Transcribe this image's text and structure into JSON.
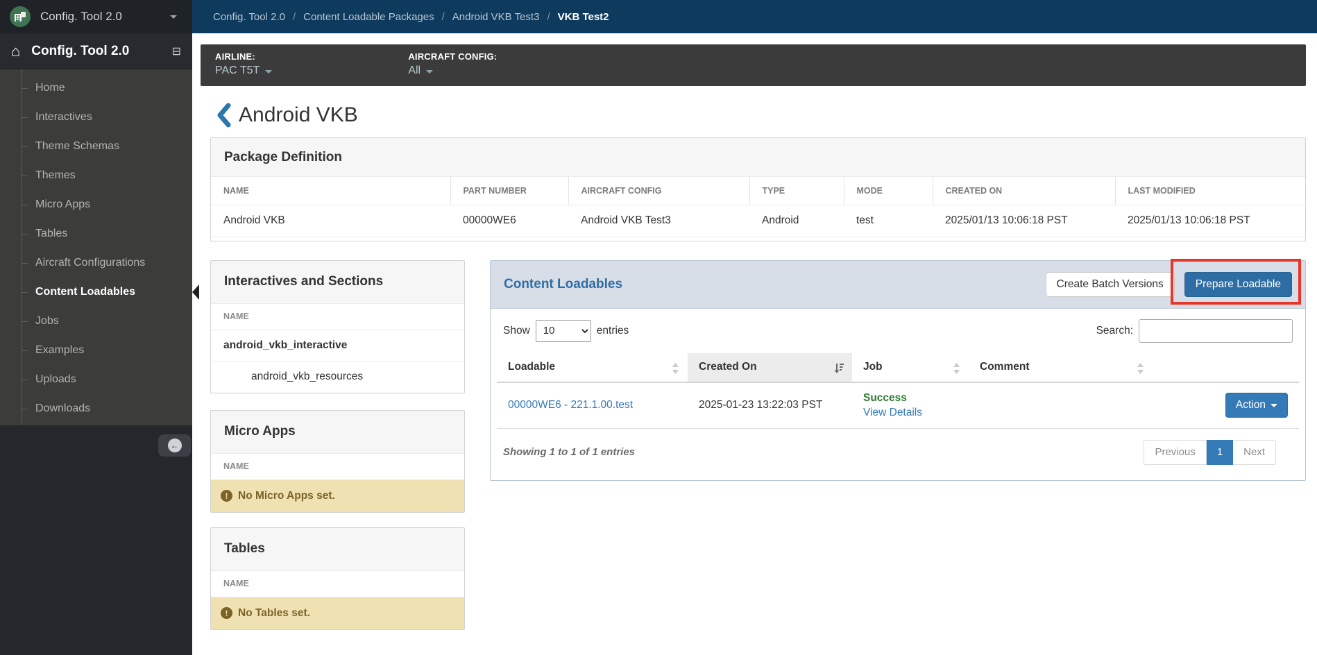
{
  "sidebar": {
    "brand_label": "Config. Tool 2.0",
    "header_label": "Config. Tool 2.0",
    "items": [
      {
        "label": "Home",
        "active": false
      },
      {
        "label": "Interactives",
        "active": false
      },
      {
        "label": "Theme Schemas",
        "active": false
      },
      {
        "label": "Themes",
        "active": false
      },
      {
        "label": "Micro Apps",
        "active": false
      },
      {
        "label": "Tables",
        "active": false
      },
      {
        "label": "Aircraft Configurations",
        "active": false
      },
      {
        "label": "Content Loadables",
        "active": true
      },
      {
        "label": "Jobs",
        "active": false
      },
      {
        "label": "Examples",
        "active": false
      },
      {
        "label": "Uploads",
        "active": false
      },
      {
        "label": "Downloads",
        "active": false
      }
    ]
  },
  "breadcrumb": {
    "separator": "/",
    "items": [
      "Config. Tool 2.0",
      "Content Loadable Packages",
      "Android VKB Test3",
      "VKB Test2"
    ]
  },
  "filter_bar": {
    "airline_label": "AIRLINE:",
    "airline_value": "PAC T5T",
    "aircraft_label": "AIRCRAFT CONFIG:",
    "aircraft_value": "All"
  },
  "page": {
    "title": "Android VKB"
  },
  "package_definition": {
    "title": "Package Definition",
    "columns": [
      "NAME",
      "PART NUMBER",
      "AIRCRAFT CONFIG",
      "TYPE",
      "MODE",
      "CREATED ON",
      "LAST MODIFIED"
    ],
    "values": [
      "Android VKB",
      "00000WE6",
      "Android VKB Test3",
      "Android",
      "test",
      "2025/01/13 10:06:18 PST",
      "2025/01/13 10:06:18 PST"
    ]
  },
  "interactives": {
    "title": "Interactives and Sections",
    "name_header": "NAME",
    "rows": [
      {
        "label": "android_vkb_interactive"
      },
      {
        "label": "android_vkb_resources"
      }
    ]
  },
  "micro_apps": {
    "title": "Micro Apps",
    "name_header": "NAME",
    "empty_message": "No Micro Apps set.",
    "warn_glyph": "!"
  },
  "tables_panel": {
    "title": "Tables",
    "name_header": "NAME",
    "empty_message": "No Tables set.",
    "warn_glyph": "!"
  },
  "content_loadables": {
    "title": "Content Loadables",
    "create_batch_label": "Create Batch Versions",
    "prepare_label": "Prepare Loadable",
    "show_label": "Show",
    "page_size": "10",
    "entries_label": "entries",
    "search_label": "Search:",
    "search_value": "",
    "columns": [
      "Loadable",
      "Created On",
      "Job",
      "Comment"
    ],
    "row": {
      "loadable": "00000WE6 - 221.1.00.test",
      "created_on": "2025-01-23 13:22:03 PST",
      "job_status": "Success",
      "job_link": "View Details",
      "comment": "",
      "action_label": "Action"
    },
    "summary": "Showing 1 to 1 of 1 entries",
    "pagination": {
      "previous": "Previous",
      "page": "1",
      "next": "Next"
    }
  },
  "colors": {
    "accent_blue": "#337ab7",
    "panel_title_blue": "#2e6da4",
    "link_blue": "#3579b8",
    "success_green": "#2e7d32",
    "warning_bg": "#f0e1b2",
    "warning_text": "#7a6228",
    "annotation_red": "#e8352a",
    "breadcrumb_navy": "#0e3a5e"
  }
}
